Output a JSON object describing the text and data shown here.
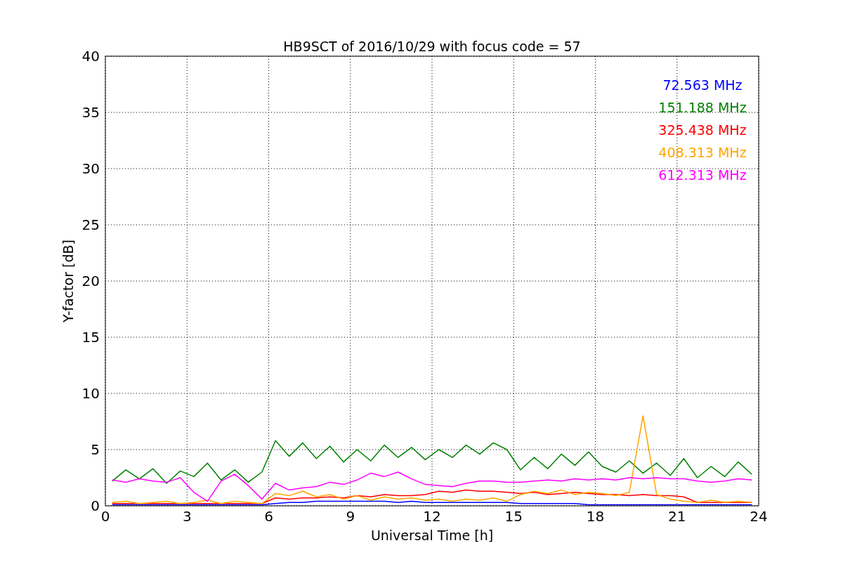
{
  "chart_data": {
    "type": "line",
    "title": "HB9SCT of 2016/10/29 with focus code = 57",
    "xlabel": "Universal Time [h]",
    "ylabel": "Y-factor [dB]",
    "x": [
      0.25,
      0.75,
      1.25,
      1.75,
      2.25,
      2.75,
      3.25,
      3.75,
      4.25,
      4.75,
      5.25,
      5.75,
      6.25,
      6.75,
      7.25,
      7.75,
      8.25,
      8.75,
      9.25,
      9.75,
      10.25,
      10.75,
      11.25,
      11.75,
      12.25,
      12.75,
      13.25,
      13.75,
      14.25,
      14.75,
      15.25,
      15.75,
      16.25,
      16.75,
      17.25,
      17.75,
      18.25,
      18.75,
      19.25,
      19.75,
      20.25,
      20.75,
      21.25,
      21.75,
      22.25,
      22.75,
      23.25,
      23.75
    ],
    "series": [
      {
        "name": "72.563 MHz",
        "color": "#0000ff",
        "values": [
          0.1,
          0.1,
          0.1,
          0.1,
          0.1,
          0.1,
          0.1,
          0.1,
          0.1,
          0.1,
          0.1,
          0.1,
          0.2,
          0.3,
          0.3,
          0.4,
          0.4,
          0.4,
          0.4,
          0.4,
          0.4,
          0.3,
          0.4,
          0.3,
          0.3,
          0.3,
          0.3,
          0.3,
          0.3,
          0.3,
          0.2,
          0.2,
          0.2,
          0.2,
          0.2,
          0.1,
          0.1,
          0.1,
          0.1,
          0.1,
          0.1,
          0.1,
          0.1,
          0.1,
          0.1,
          0.1,
          0.1,
          0.1
        ]
      },
      {
        "name": "151.188 MHz",
        "color": "#008000",
        "values": [
          2.2,
          3.2,
          2.4,
          3.3,
          2.0,
          3.1,
          2.6,
          3.8,
          2.3,
          3.2,
          2.1,
          3.0,
          5.8,
          4.4,
          5.6,
          4.2,
          5.3,
          3.9,
          5.0,
          4.0,
          5.4,
          4.3,
          5.2,
          4.1,
          5.0,
          4.3,
          5.4,
          4.6,
          5.6,
          5.0,
          3.2,
          4.3,
          3.3,
          4.6,
          3.6,
          4.8,
          3.5,
          3.0,
          4.0,
          2.9,
          3.8,
          2.7,
          4.2,
          2.5,
          3.5,
          2.6,
          3.9,
          2.8
        ]
      },
      {
        "name": "325.438 MHz",
        "color": "#ff0000",
        "values": [
          0.2,
          0.2,
          0.2,
          0.2,
          0.2,
          0.2,
          0.2,
          0.2,
          0.2,
          0.2,
          0.2,
          0.2,
          0.7,
          0.6,
          0.7,
          0.7,
          0.8,
          0.7,
          0.9,
          0.8,
          1.0,
          0.9,
          0.9,
          1.0,
          1.3,
          1.2,
          1.4,
          1.3,
          1.3,
          1.2,
          1.1,
          1.2,
          1.0,
          1.1,
          1.2,
          1.1,
          1.0,
          1.0,
          0.9,
          1.0,
          0.9,
          0.9,
          0.8,
          0.3,
          0.3,
          0.3,
          0.3,
          0.3
        ]
      },
      {
        "name": "408.313 MHz",
        "color": "#ffa500",
        "values": [
          0.3,
          0.4,
          0.2,
          0.3,
          0.4,
          0.2,
          0.3,
          0.5,
          0.2,
          0.4,
          0.3,
          0.2,
          1.1,
          0.9,
          1.3,
          0.8,
          1.0,
          0.6,
          0.9,
          0.5,
          0.8,
          0.6,
          0.7,
          0.5,
          0.6,
          0.4,
          0.6,
          0.5,
          0.7,
          0.4,
          1.0,
          1.3,
          1.1,
          1.4,
          1.0,
          1.2,
          1.1,
          0.9,
          1.2,
          8.0,
          1.0,
          0.6,
          0.4,
          0.3,
          0.5,
          0.3,
          0.4,
          0.3
        ]
      },
      {
        "name": "612.313 MHz",
        "color": "#ff00ff",
        "values": [
          2.3,
          2.1,
          2.4,
          2.2,
          2.1,
          2.5,
          1.2,
          0.4,
          2.2,
          2.8,
          1.8,
          0.6,
          2.0,
          1.4,
          1.6,
          1.7,
          2.1,
          1.9,
          2.3,
          2.9,
          2.6,
          3.0,
          2.4,
          1.9,
          1.8,
          1.7,
          2.0,
          2.2,
          2.2,
          2.1,
          2.1,
          2.2,
          2.3,
          2.2,
          2.4,
          2.3,
          2.4,
          2.3,
          2.5,
          2.4,
          2.5,
          2.4,
          2.4,
          2.2,
          2.1,
          2.2,
          2.4,
          2.3
        ]
      }
    ],
    "grid": true,
    "xlim": [
      0,
      24
    ],
    "ylim": [
      0,
      40
    ],
    "xticks": [
      0,
      3,
      6,
      9,
      12,
      15,
      18,
      21,
      24
    ],
    "yticks": [
      0,
      5,
      10,
      15,
      20,
      25,
      30,
      35,
      40
    ]
  }
}
